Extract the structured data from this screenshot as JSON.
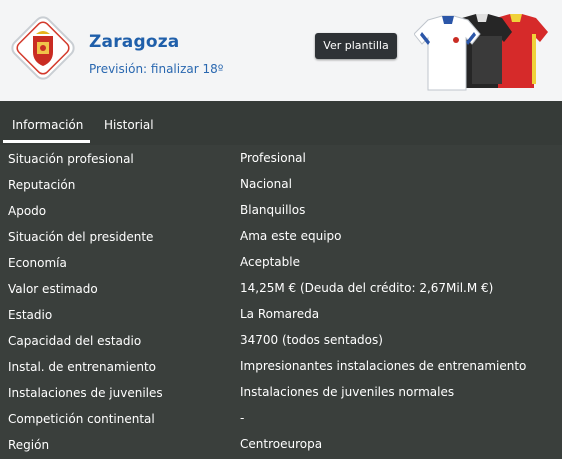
{
  "header": {
    "club_name": "Zaragoza",
    "forecast": "Previsión: finalizar 18º",
    "squad_button": "Ver plantilla",
    "crest_icon": "real-zaragoza-crest-icon",
    "kits_icon": "team-kits-icon"
  },
  "tabs": [
    {
      "label": "Información",
      "active": true
    },
    {
      "label": "Historial",
      "active": false
    }
  ],
  "info": [
    {
      "label": "Situación profesional",
      "value": "Profesional"
    },
    {
      "label": "Reputación",
      "value": "Nacional"
    },
    {
      "label": "Apodo",
      "value": "Blanquillos"
    },
    {
      "label": "Situación del presidente",
      "value": "Ama este equipo"
    },
    {
      "label": "Economía",
      "value": "Aceptable"
    },
    {
      "label": "Valor estimado",
      "value": "14,25M € (Deuda del crédito: 2,67Mil.M €)"
    },
    {
      "label": "Estadio",
      "value": "La Romareda"
    },
    {
      "label": "Capacidad del estadio",
      "value": "34700 (todos sentados)"
    },
    {
      "label": "Instal. de entrenamiento",
      "value": "Impresionantes instalaciones de entrenamiento"
    },
    {
      "label": "Instalaciones de juveniles",
      "value": "Instalaciones de juveniles normales"
    },
    {
      "label": "Competición continental",
      "value": "-"
    },
    {
      "label": "Región",
      "value": "Centroeuropa"
    }
  ],
  "colors": {
    "header_bg": "#f4f5f6",
    "body_bg": "#3a3f3c",
    "club_blue": "#1f5faa",
    "button_bg": "#2e3236"
  }
}
